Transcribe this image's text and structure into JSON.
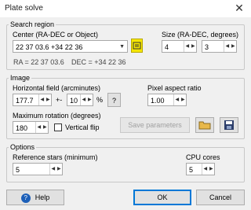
{
  "window": {
    "title": "Plate solve",
    "close_glyph": "✕"
  },
  "search_region": {
    "legend": "Search region",
    "center_label": "Center (RA-DEC or Object)",
    "center_value": "22 37 03.6 +34 22 36",
    "ra_text": "RA = 22 37 03.6",
    "dec_text": "DEC = +34 22 36",
    "size_label": "Size (RA-DEC, degrees)",
    "size_ra": "4",
    "size_dec": "3"
  },
  "image": {
    "legend": "Image",
    "hfield_label": "Horizontal field (arcminutes)",
    "hfield_value": "177.7",
    "tolerance_prefix": "+-",
    "tolerance_value": "10",
    "tolerance_unit": "%",
    "help_q": "?",
    "pixel_ratio_label": "Pixel aspect ratio",
    "pixel_ratio_value": "1.00",
    "max_rotation_label": "Maximum rotation (degrees)",
    "max_rotation_value": "180",
    "vertical_flip_label": "Vertical flip",
    "save_parameters_label": "Save parameters"
  },
  "options": {
    "legend": "Options",
    "ref_stars_label": "Reference stars (minimum)",
    "ref_stars_value": "5",
    "cpu_cores_label": "CPU cores",
    "cpu_cores_value": "5"
  },
  "footer": {
    "help_label": "Help",
    "ok_label": "OK",
    "cancel_label": "Cancel"
  },
  "colors": {
    "accent_blue": "#0078d7",
    "highlight_yellow": "#f5e600",
    "folder_yellow": "#e8b84a",
    "floppy_navy": "#2c3e6b"
  }
}
